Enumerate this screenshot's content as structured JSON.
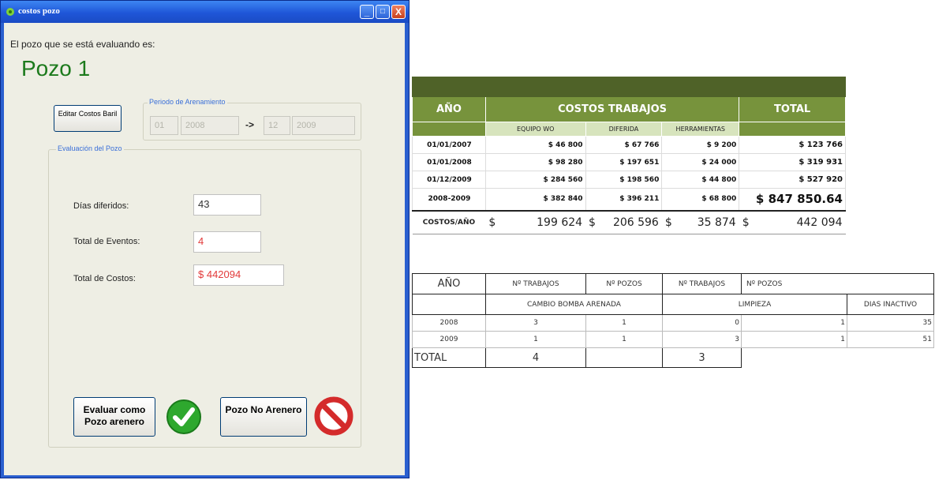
{
  "window": {
    "title": "costos pozo",
    "buttons": {
      "minimize": "_",
      "maximize": "□",
      "close": "X"
    }
  },
  "form": {
    "evaluating_label": "El pozo que se está evaluando es:",
    "pozo_name": "Pozo 1",
    "edit_costs_button": "Editar Costos Baril",
    "period_group_title": "Periodo de Arenamiento",
    "period": {
      "start_month": "01",
      "start_year": "2008",
      "arrow": "->",
      "end_month": "12",
      "end_year": "2009"
    },
    "evaluation_group_title": "Evaluación del Pozo",
    "dias_diferidos_label": "Días diferidos:",
    "dias_diferidos_value": "43",
    "total_eventos_label": "Total de Eventos:",
    "total_eventos_value": "4",
    "total_costos_label": "Total de Costos:",
    "total_costos_value": "$ 442094",
    "evaluate_button": "Evaluar como Pozo arenero",
    "not_sand_button": "Pozo No Arenero",
    "icons": {
      "check": "green-check-icon",
      "no": "prohibited-icon"
    },
    "colors": {
      "pozo_title": "#1c7a1c",
      "field_red": "#e23a3a",
      "check": "#2ea82e",
      "no": "#d42b2b"
    }
  },
  "sheet1": {
    "headers": {
      "year": "AÑO",
      "costs": "COSTOS TRABAJOS",
      "total": "TOTAL"
    },
    "subheaders": [
      "EQUIPO WO",
      "DIFERIDA",
      "HERRAMIENTAS"
    ],
    "rows": [
      {
        "date": "01/01/2007",
        "equipo": "$ 46 800",
        "diferida": "$ 67 766",
        "herr": "$ 9 200",
        "total": "$ 123 766"
      },
      {
        "date": "01/01/2008",
        "equipo": "$ 98 280",
        "diferida": "$ 197 651",
        "herr": "$ 24 000",
        "total": "$ 319 931"
      },
      {
        "date": "01/12/2009",
        "equipo": "$ 284 560",
        "diferida": "$ 198 560",
        "herr": "$ 44 800",
        "total": "$ 527 920"
      },
      {
        "date": "2008-2009",
        "equipo": "$ 382 840",
        "diferida": "$ 396 211",
        "herr": "$ 68 800",
        "total": "$ 847 850.64"
      }
    ],
    "costs_row": {
      "label": "COSTOS/AÑO",
      "currency": "$",
      "equipo": "199 624",
      "diferida": "206 596",
      "herr": "35 874",
      "total": "442 094"
    },
    "colors": {
      "band": "#4f6228",
      "header": "#77933c",
      "subheader": "#d7e4bd"
    }
  },
  "sheet2": {
    "row1": {
      "year": "AÑO",
      "trabajos1": "Nº TRABAJOS",
      "pozos1": "Nº POZOS",
      "trabajos2": "Nº TRABAJOS",
      "pozos2": "Nº POZOS"
    },
    "row2": {
      "group1": "CAMBIO BOMBA ARENADA",
      "group2": "LIMPIEZA",
      "dias": "DIAS INACTIVO"
    },
    "rows": [
      {
        "year": "2008",
        "t1": "3",
        "p1": "1",
        "t2": "0",
        "p2": "1",
        "dias": "35"
      },
      {
        "year": "2009",
        "t1": "1",
        "p1": "1",
        "t2": "3",
        "p2": "1",
        "dias": "51"
      }
    ],
    "total": {
      "label": "TOTAL",
      "t1": "4",
      "t2": "3"
    }
  }
}
